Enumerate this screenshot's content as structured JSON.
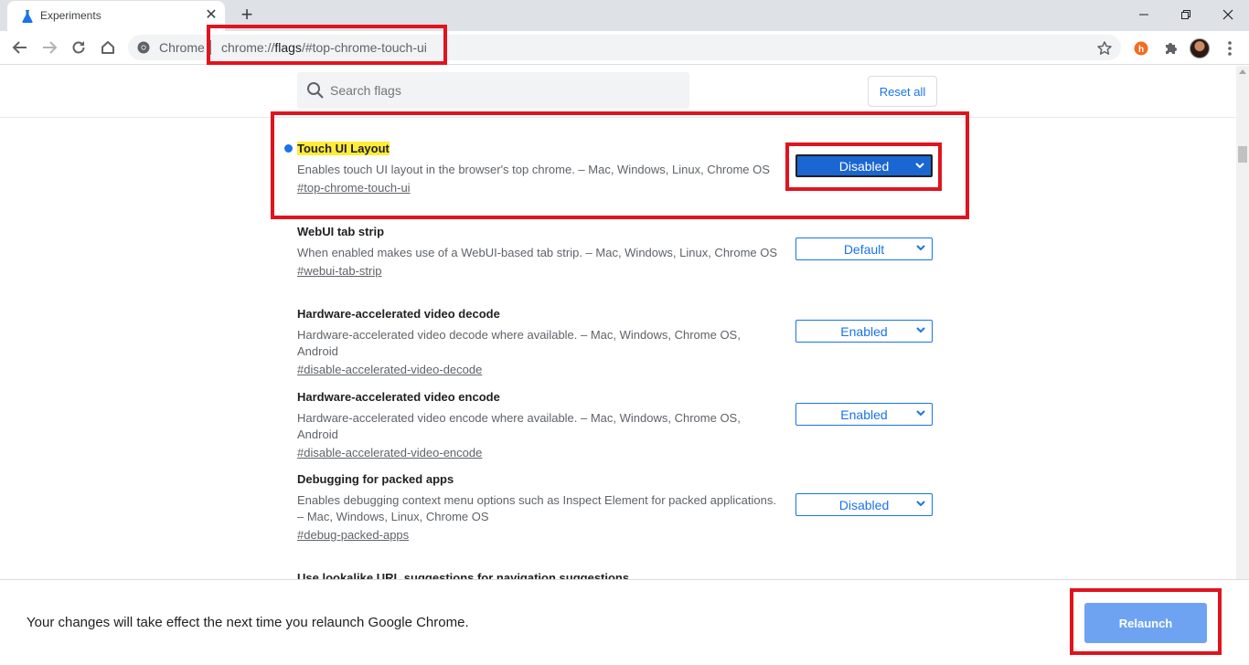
{
  "browser": {
    "tab_title": "Experiments",
    "site_chip": "Chrome",
    "url_prefix": "chrome://",
    "url_host": "flags",
    "url_path": "/#top-chrome-touch-ui"
  },
  "header": {
    "search_placeholder": "Search flags",
    "reset_all_label": "Reset all"
  },
  "experiments": [
    {
      "title": "Touch UI Layout",
      "description": "Enables touch UI layout in the browser's top chrome. – Mac, Windows, Linux, Chrome OS",
      "link": "#top-chrome-touch-ui",
      "value": "Disabled"
    },
    {
      "title": "WebUI tab strip",
      "description": "When enabled makes use of a WebUI-based tab strip. – Mac, Windows, Linux, Chrome OS",
      "link": "#webui-tab-strip",
      "value": "Default"
    },
    {
      "title": "Hardware-accelerated video decode",
      "description": "Hardware-accelerated video decode where available. – Mac, Windows, Chrome OS, Android",
      "link": "#disable-accelerated-video-decode",
      "value": "Enabled"
    },
    {
      "title": "Hardware-accelerated video encode",
      "description": "Hardware-accelerated video encode where available. – Mac, Windows, Chrome OS, Android",
      "link": "#disable-accelerated-video-encode",
      "value": "Enabled"
    },
    {
      "title": "Debugging for packed apps",
      "description": "Enables debugging context menu options such as Inspect Element for packed applications. – Mac, Windows, Linux, Chrome OS",
      "link": "#debug-packed-apps",
      "value": "Disabled"
    },
    {
      "title": "Use lookalike URL suggestions for navigation suggestions"
    }
  ],
  "relaunch": {
    "message": "Your changes will take effect the next time you relaunch Google Chrome.",
    "button_label": "Relaunch"
  },
  "colors": {
    "accent": "#1a73e8",
    "annotation_red": "#e0141e",
    "highlight_yellow": "#ffeb3b",
    "relaunch_button": "#6ea3f2"
  }
}
